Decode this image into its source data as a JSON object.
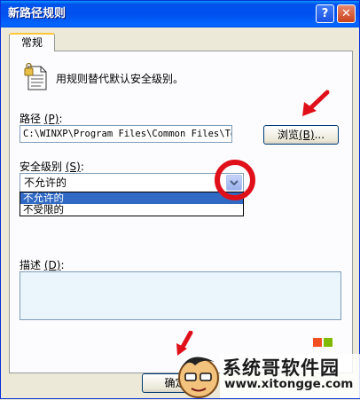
{
  "window": {
    "title": "新路径规则"
  },
  "title_buttons": {
    "help": "?",
    "close": "✕"
  },
  "tabs": [
    {
      "label": "常规"
    }
  ],
  "description": "用规则替代默认安全级别。",
  "path": {
    "label": "路径",
    "accel": "(P)",
    "colon": ":",
    "value": "C:\\WINXP\\Program Files\\Common Files\\Ter",
    "browse_label": "浏览",
    "browse_accel": "(B)",
    "browse_suffix": "..."
  },
  "security_level": {
    "label": "安全级别",
    "accel": "(S)",
    "colon": ":",
    "selected": "不允许的",
    "options": [
      "不允许的",
      "不受限的"
    ]
  },
  "desc_field": {
    "label": "描述",
    "accel": "(D)",
    "colon": ":",
    "value": ""
  },
  "buttons": {
    "ok": "确定"
  },
  "watermark": {
    "site": "系统哥软件园",
    "url": "www.xitongge.com"
  },
  "colors": {
    "title_bar": "#0055ea",
    "highlight": "#316ac5",
    "annotation_red": "#e0101a"
  }
}
